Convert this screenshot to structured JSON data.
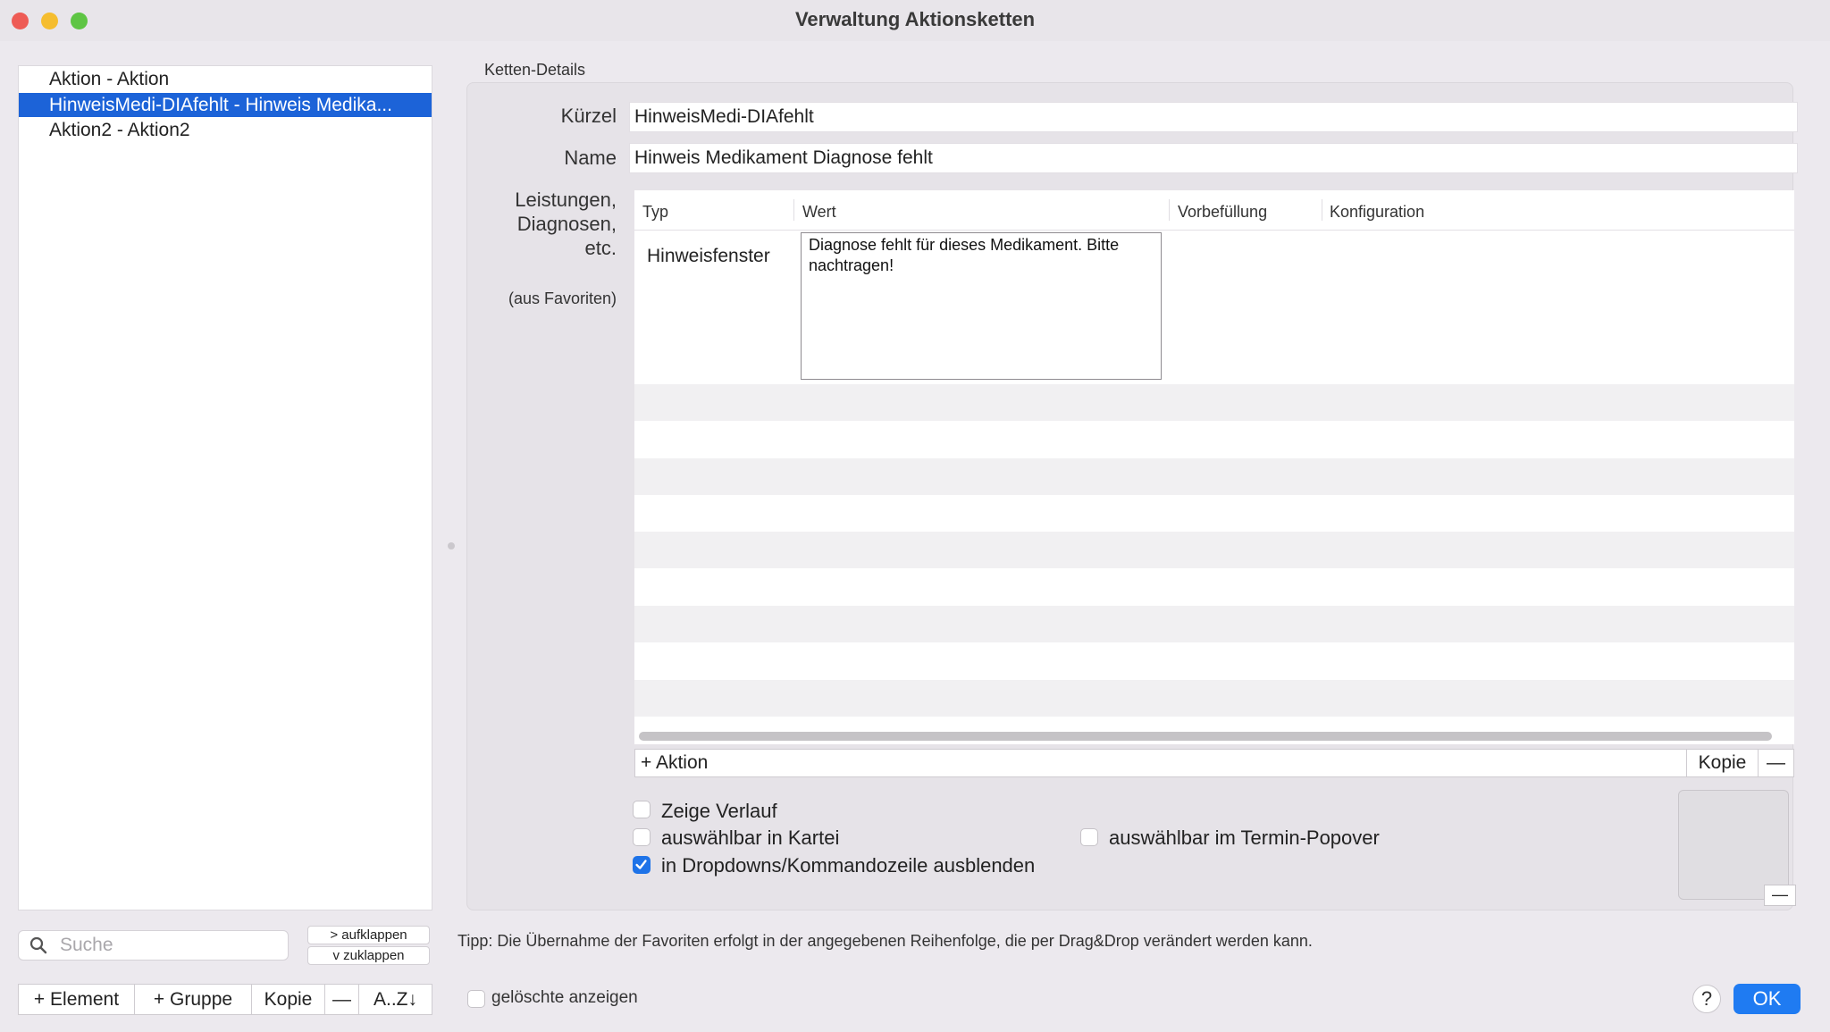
{
  "window": {
    "title": "Verwaltung Aktionsketten"
  },
  "list": {
    "items": [
      {
        "label": "Aktion - Aktion"
      },
      {
        "label": "HinweisMedi-DIAfehlt - Hinweis Medika..."
      },
      {
        "label": "Aktion2 - Aktion2"
      }
    ],
    "selected_index": 1
  },
  "search": {
    "placeholder": "Suche"
  },
  "expand": {
    "expand_label": "> aufklappen",
    "collapse_label": "v  zuklappen"
  },
  "left_toolbar": {
    "add_element": "+ Element",
    "add_group": "+ Gruppe",
    "copy": "Kopie",
    "remove": "—",
    "sort": "A..Z↓"
  },
  "details": {
    "group_title": "Ketten-Details",
    "kuerzel_label": "Kürzel",
    "kuerzel_value": "HinweisMedi-DIAfehlt",
    "name_label": "Name",
    "name_value": "Hinweis Medikament Diagnose fehlt",
    "leistungen_label_1": "Leistungen,",
    "leistungen_label_2": "Diagnosen,",
    "leistungen_label_3": "etc.",
    "favoriten_note": "(aus Favoriten)"
  },
  "table": {
    "columns": [
      "Typ",
      "Wert",
      "Vorbefüllung",
      "Konfiguration"
    ],
    "rows": [
      {
        "typ": "Hinweisfenster",
        "wert": "Diagnose fehlt für dieses Medikament. Bitte nachtragen!",
        "vorbefuellung": "",
        "konfiguration": ""
      }
    ]
  },
  "action_bar": {
    "add_action": "+ Aktion",
    "copy": "Kopie",
    "remove": "—"
  },
  "options": {
    "zeige_verlauf": {
      "label": "Zeige Verlauf",
      "checked": false
    },
    "auswaehlbar_kartei": {
      "label": "auswählbar in Kartei",
      "checked": false
    },
    "auswaehlbar_termin": {
      "label": "auswählbar im Termin-Popover",
      "checked": false
    },
    "ausblenden": {
      "label": "in Dropdowns/Kommandozeile ausblenden",
      "checked": true
    }
  },
  "preview": {
    "remove": "—"
  },
  "tip": "Tipp: Die Übernahme der Favoriten erfolgt in der angegebenen Reihenfolge, die per Drag&Drop verändert werden kann.",
  "footer": {
    "show_deleted": "gelöschte anzeigen",
    "show_deleted_checked": false,
    "help": "?",
    "ok": "OK"
  },
  "colors": {
    "accent": "#1f7bf2",
    "selection": "#1c63d8",
    "close": "#ee5b55",
    "minimize": "#f5bd2f",
    "zoom": "#5ec544"
  }
}
